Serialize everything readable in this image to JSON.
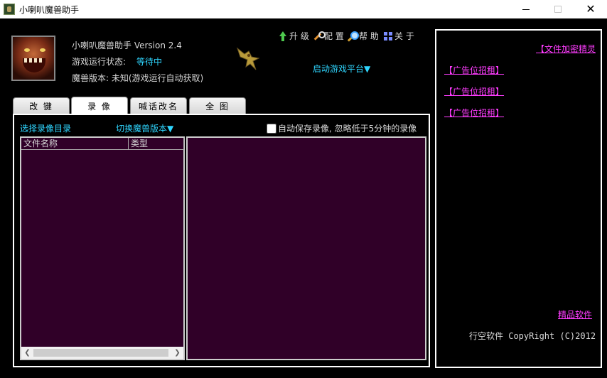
{
  "window": {
    "title": "小喇叭魔兽助手",
    "minimize_glyph": "—",
    "maximize_glyph": "☐",
    "close_glyph": "✕"
  },
  "header": {
    "version_text": "小喇叭魔兽助手 Version 2.4",
    "status_label": "游戏运行状态:",
    "status_value": "等待中",
    "warcraft_version": "魔兽版本: 未知(游戏运行自动获取)",
    "menu": {
      "upgrade": "升 级",
      "config": "配 置",
      "help": "帮 助",
      "about": "关 于"
    },
    "launch_platform": "启动游戏平台▼"
  },
  "tabs": [
    {
      "label": "改 键"
    },
    {
      "label": "录 像",
      "active": true
    },
    {
      "label": "喊话改名"
    },
    {
      "label": "全 图"
    }
  ],
  "replay": {
    "choose_dir": "选择录像目录",
    "switch_version": "切换魔兽版本▼",
    "auto_save_label": "自动保存录像, 忽略低于5分钟的录像",
    "auto_save_checked": false,
    "columns": [
      "文件名称",
      "类型"
    ],
    "rows": [],
    "scroll_left": "❮",
    "scroll_right": "❯"
  },
  "side": {
    "encrypt_link": "【文件加密精灵",
    "ads": [
      "【广告位招租】",
      "【广告位招租】",
      "【广告位招租】"
    ],
    "fine_software": "精品软件",
    "copyright": "行空软件 CopyRight (C)2012"
  },
  "colors": {
    "accent_cyan": "#2fd6ff",
    "link_magenta": "#ff3cff",
    "panel_purple": "#300028"
  }
}
